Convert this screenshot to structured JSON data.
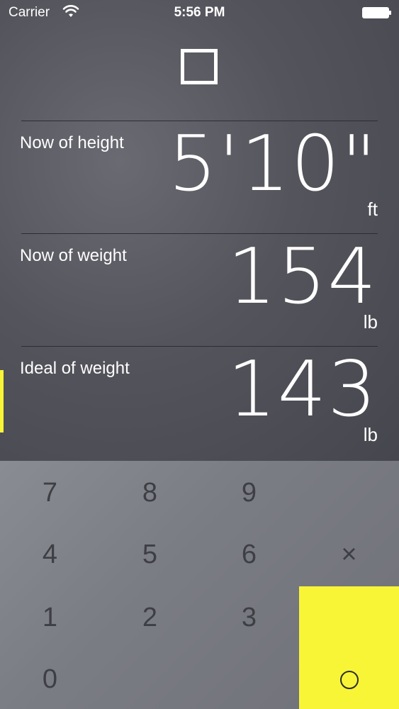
{
  "status_bar": {
    "carrier": "Carrier",
    "time": "5:56 PM"
  },
  "app": {
    "logo_icon": "square-outline-icon"
  },
  "fields": [
    {
      "label": "Now of height",
      "value": "5'10\"",
      "unit": "ft",
      "active": false
    },
    {
      "label": "Now of weight",
      "value": "154",
      "unit": "lb",
      "active": false
    },
    {
      "label": "Ideal of weight",
      "value": "143",
      "unit": "lb",
      "active": true
    }
  ],
  "keypad": {
    "keys": [
      "7",
      "8",
      "9",
      "4",
      "5",
      "6",
      "1",
      "2",
      "3",
      "0"
    ],
    "clear_key": "×",
    "ok_icon": "circle-icon"
  },
  "colors": {
    "accent": "#f8f536",
    "background": "#4f5059",
    "keypad_text": "#3e3f45"
  }
}
